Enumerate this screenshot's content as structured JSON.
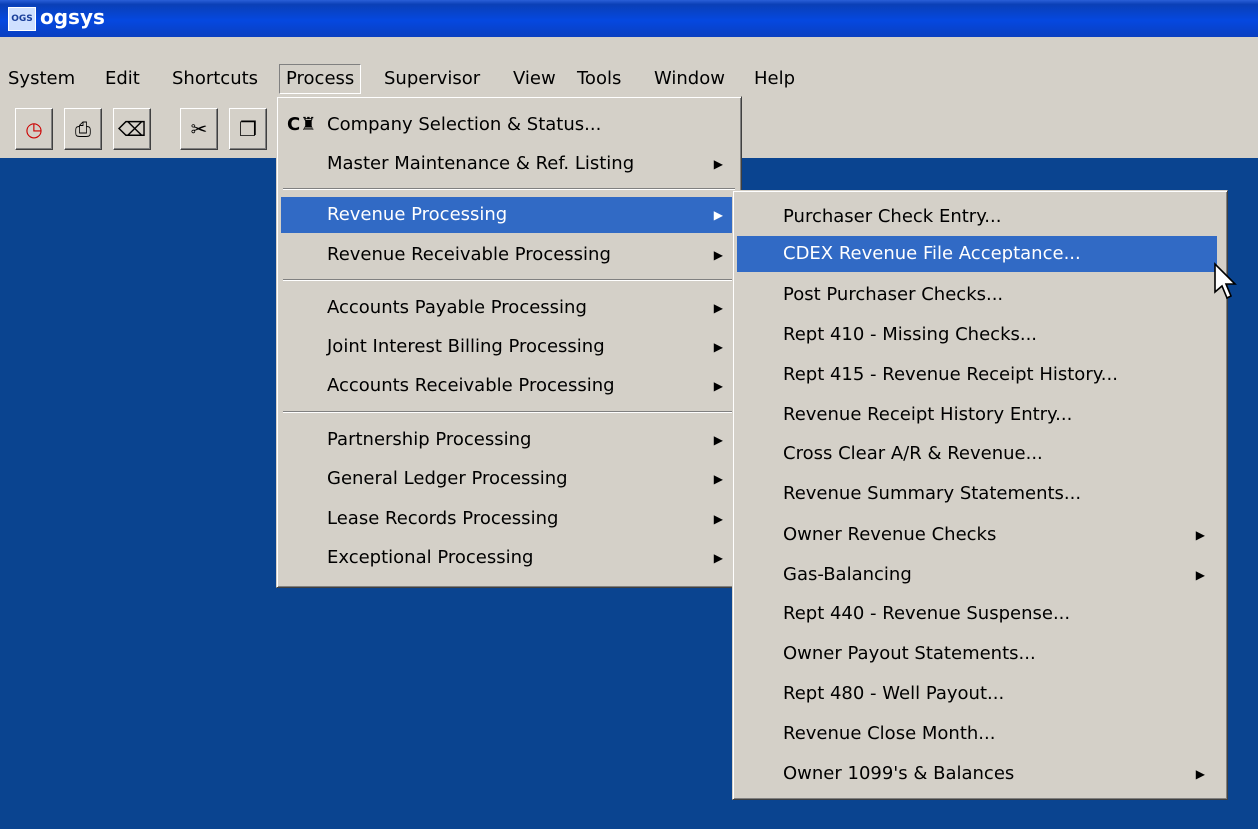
{
  "window": {
    "title": "ogsys",
    "icon": "OGS"
  },
  "menubar": {
    "system": "System",
    "edit": "Edit",
    "shortcuts": "Shortcuts",
    "process": "Process",
    "supervisor": "Supervisor",
    "view": "View",
    "tools": "Tools",
    "window": "Window",
    "help": "Help"
  },
  "toolbar": {
    "icons": [
      "calendar-clock-icon",
      "print-icon",
      "eraser-icon",
      "cut-icon",
      "copy-icon"
    ]
  },
  "process_menu": {
    "items": [
      "Company Selection & Status...",
      "Master Maintenance & Ref. Listing",
      "Revenue Processing",
      "Revenue Receivable Processing",
      "Accounts Payable Processing",
      "Joint Interest Billing Processing",
      "Accounts Receivable Processing",
      "Partnership Processing",
      "General Ledger Processing",
      "Lease Records Processing",
      "Exceptional Processing"
    ]
  },
  "revenue_submenu": {
    "items": [
      "Purchaser Check Entry...",
      "CDEX Revenue File Acceptance...",
      "Post Purchaser Checks...",
      "Rept 410 - Missing Checks...",
      "Rept 415 - Revenue Receipt History...",
      "Revenue Receipt History Entry...",
      "Cross Clear A/R & Revenue...",
      "Revenue Summary Statements...",
      "Owner Revenue Checks",
      "Gas-Balancing",
      "Rept 440 - Revenue Suspense...",
      "Owner Payout Statements...",
      "Rept 480 - Well Payout...",
      "Revenue Close Month...",
      "Owner 1099's & Balances"
    ]
  },
  "colors": {
    "highlight": "#316ac5",
    "desktop": "#0a4490",
    "titlebar": "#0548e0"
  }
}
